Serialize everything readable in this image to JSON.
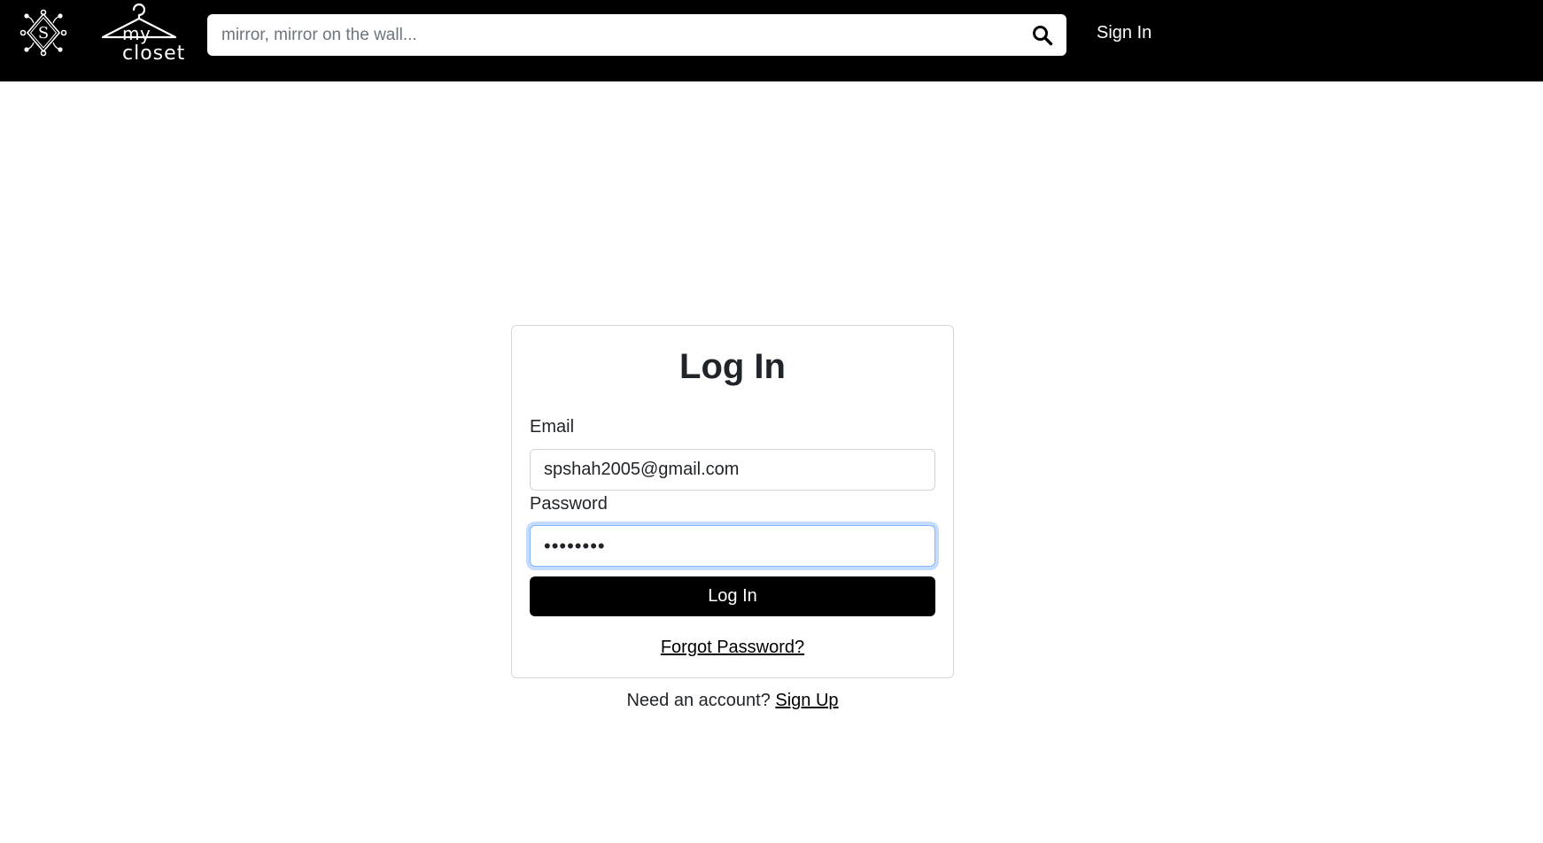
{
  "header": {
    "logo_s_letter": "S",
    "logo_my": "my",
    "logo_closet": "closet",
    "search_placeholder": "mirror, mirror on the wall...",
    "search_icon": "search-icon",
    "signin_label": "Sign In"
  },
  "login": {
    "title": "Log In",
    "email_label": "Email",
    "email_value": "spshah2005@gmail.com",
    "password_label": "Password",
    "password_value": "••••••••",
    "submit_label": "Log In",
    "forgot_label": "Forgot Password?",
    "need_account_text": "Need an account?",
    "signup_label": "Sign Up"
  },
  "colors": {
    "navbar_bg": "#000000",
    "primary_button": "#000000",
    "focus_ring": "#86b7fe"
  }
}
